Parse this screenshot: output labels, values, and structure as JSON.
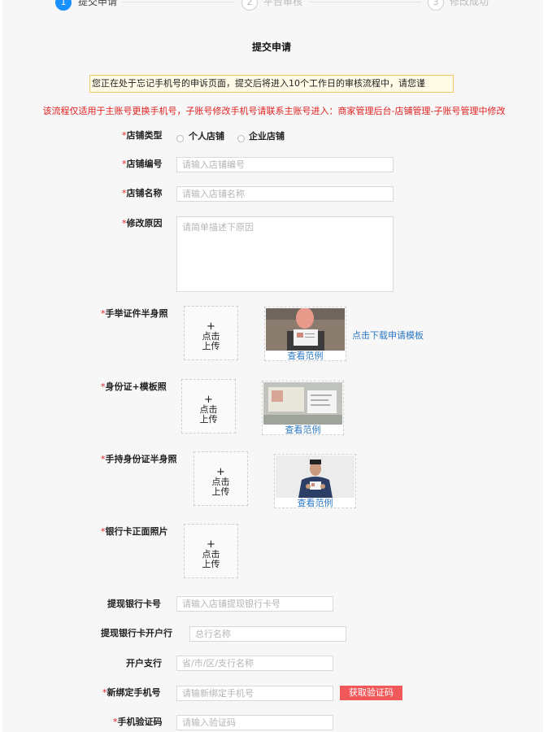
{
  "steps": [
    {
      "number": "1",
      "label": "提交申请"
    },
    {
      "number": "2",
      "label": "平台审核"
    },
    {
      "number": "3",
      "label": "修改成功"
    }
  ],
  "page_title": "提交申请",
  "notice": "您正在处于忘记手机号的申诉页面，提交后将进入10个工作日的审核流程中，请您谨",
  "warning": "该流程仅适用于主账号更换手机号，子账号修改手机号请联系主账号进入：商家管理后台-店铺管理-子账号管理中修改",
  "required_mark": "*",
  "form": {
    "shop_type": {
      "label": "店铺类型",
      "options": [
        "个人店铺",
        "企业店铺"
      ]
    },
    "shop_id": {
      "label": "店铺编号",
      "placeholder": "请输入店铺编号"
    },
    "shop_name": {
      "label": "店铺名称",
      "placeholder": "请输入店铺名称"
    },
    "reason": {
      "label": "修改原因",
      "placeholder": "请简单描述下原因"
    },
    "photo_id_half": {
      "label": "手举证件半身照"
    },
    "id_template": {
      "label": "身份证+模板照"
    },
    "hold_id_half": {
      "label": "手持身份证半身照"
    },
    "bank_card_front": {
      "label": "银行卡正面照片"
    },
    "bank_card_no": {
      "label": "提现银行卡号",
      "placeholder": "请输入店铺提现银行卡号"
    },
    "bank_name": {
      "label": "提现银行卡开户行",
      "placeholder": "总行名称"
    },
    "bank_branch": {
      "label": "开户支行",
      "placeholder": "省/市/区/支行名称"
    },
    "new_phone": {
      "label": "新绑定手机号",
      "placeholder": "请输新绑定手机号"
    },
    "sms_code": {
      "label": "手机验证码",
      "placeholder": "请输入验证码"
    }
  },
  "upload": {
    "plus": "+",
    "text": "点击上传"
  },
  "sample_link": "查看范例",
  "download_link": "点击下载申请模板",
  "get_code_button": "获取验证码",
  "colors": {
    "primary": "#1890ff",
    "required": "#e02020",
    "link": "#2b78c5",
    "button": "#f0585a",
    "notice_bg": "#fffbe6",
    "notice_border": "#f2c766"
  }
}
